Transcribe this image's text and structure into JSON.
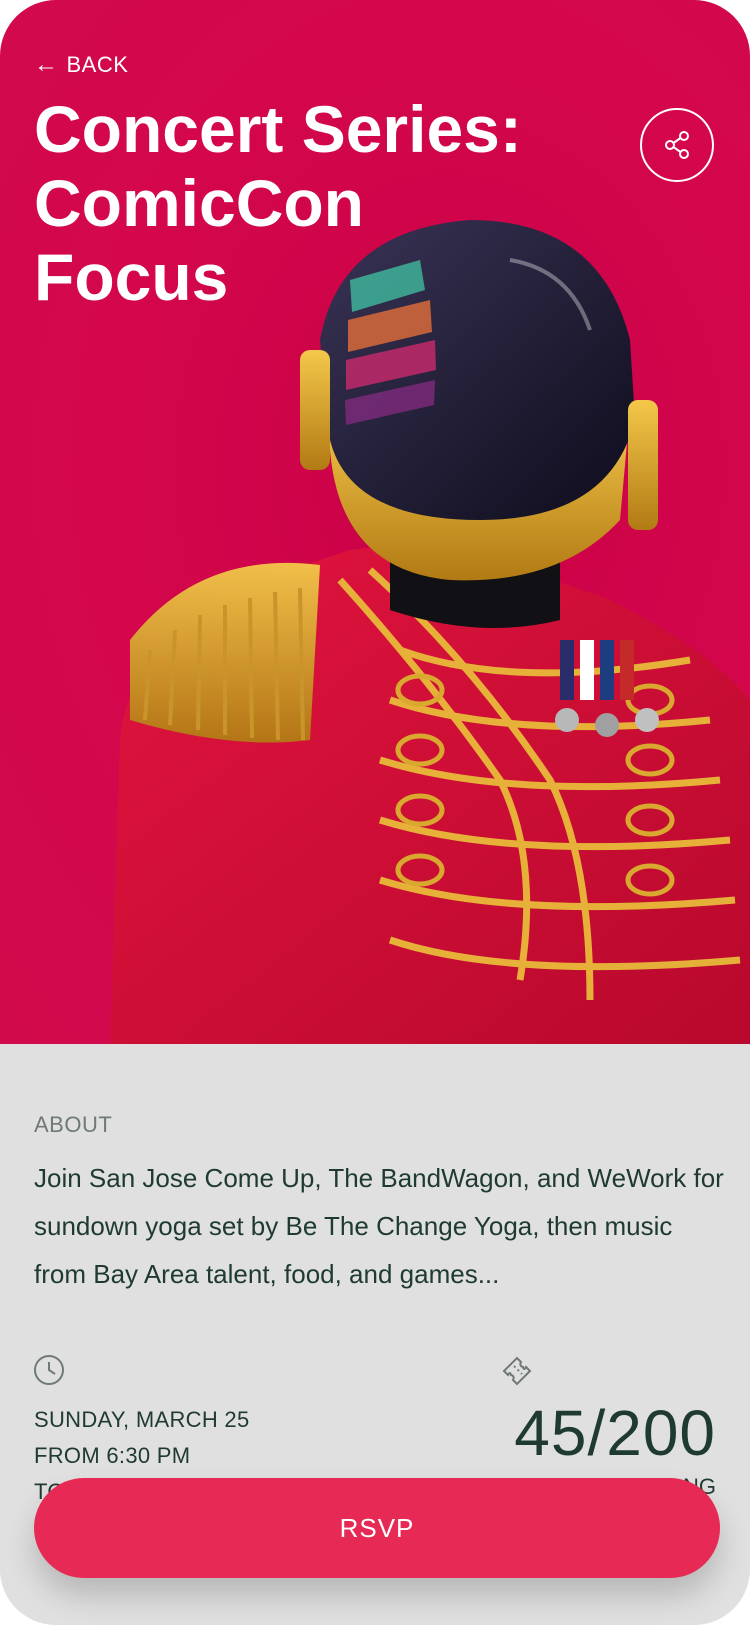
{
  "nav": {
    "back_label": "BACK",
    "back_icon": "arrow-left-icon"
  },
  "event": {
    "title_lines": [
      "Concert Series:",
      "ComicCon",
      "Focus"
    ],
    "share_icon": "share-icon",
    "hero_image": "masked performer in red ceremonial jacket with gold braid"
  },
  "about": {
    "label": "ABOUT",
    "description": "Join San Jose Come Up, The BandWagon, and WeWork for sundown yoga set by Be The Change Yoga, then music from Bay Area talent, food, and games..."
  },
  "schedule": {
    "icon": "clock-icon",
    "day": "SUNDAY, MARCH 25",
    "from": "FROM 6:30 PM",
    "to": "TO"
  },
  "attendance": {
    "icon": "ticket-icon",
    "count": "45/200",
    "label": "NG"
  },
  "cta": {
    "rsvp_label": "RSVP"
  },
  "colors": {
    "hero_bg": "#d10a4c",
    "content_bg": "#e0e0e0",
    "text_dark": "#1f3a30",
    "muted": "#6f7a75",
    "rsvp_bg": "#e62a55"
  }
}
